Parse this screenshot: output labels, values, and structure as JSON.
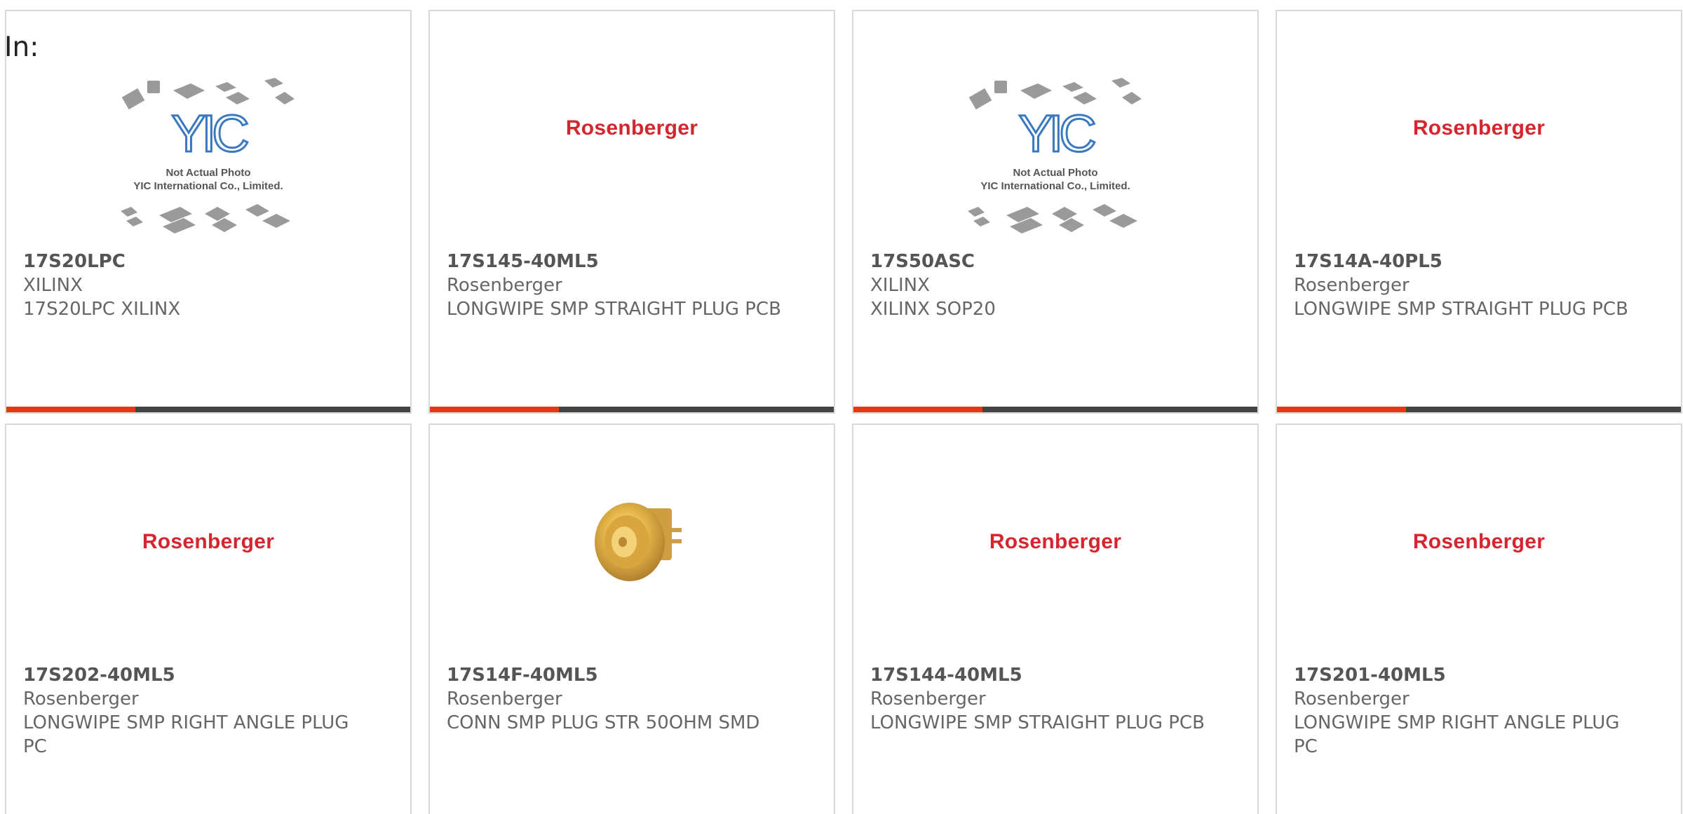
{
  "filter_label": "In:",
  "accent_color": "#e8380d",
  "bar_color": "#444444",
  "brand_color": "#d6252e",
  "yic_placeholder": {
    "logo_text": "YIC",
    "line1": "Not Actual Photo",
    "line2": "YIC International Co., Limited."
  },
  "products": [
    {
      "part_number": "17S20LPC",
      "manufacturer": "XILINX",
      "description": "17S20LPC XILINX",
      "image": "yic-placeholder"
    },
    {
      "part_number": "17S145-40ML5",
      "manufacturer": "Rosenberger",
      "description": "LONGWIPE SMP STRAIGHT PLUG PCB",
      "image": "rosenberger-logo",
      "logo_text": "Rosenberger"
    },
    {
      "part_number": "17S50ASC",
      "manufacturer": "XILINX",
      "description": "XILINX SOP20",
      "image": "yic-placeholder"
    },
    {
      "part_number": "17S14A-40PL5",
      "manufacturer": "Rosenberger",
      "description": "LONGWIPE SMP STRAIGHT PLUG PCB",
      "image": "rosenberger-logo",
      "logo_text": "Rosenberger"
    },
    {
      "part_number": "17S202-40ML5",
      "manufacturer": "Rosenberger",
      "description": "LONGWIPE SMP RIGHT ANGLE PLUG PC",
      "image": "rosenberger-logo",
      "logo_text": "Rosenberger"
    },
    {
      "part_number": "17S14F-40ML5",
      "manufacturer": "Rosenberger",
      "description": "CONN SMP PLUG STR 50OHM SMD",
      "image": "smp-connector-photo"
    },
    {
      "part_number": "17S144-40ML5",
      "manufacturer": "Rosenberger",
      "description": "LONGWIPE SMP STRAIGHT PLUG PCB",
      "image": "rosenberger-logo",
      "logo_text": "Rosenberger"
    },
    {
      "part_number": "17S201-40ML5",
      "manufacturer": "Rosenberger",
      "description": "LONGWIPE SMP RIGHT ANGLE PLUG PC",
      "image": "rosenberger-logo",
      "logo_text": "Rosenberger"
    }
  ]
}
